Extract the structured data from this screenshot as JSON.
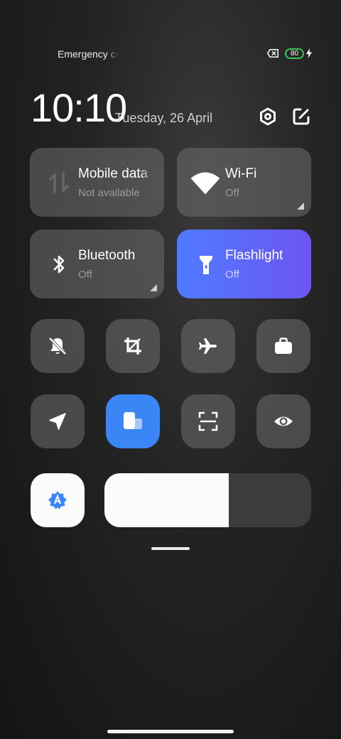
{
  "status_bar": {
    "carrier": "Emergency calls only",
    "battery_level": "80"
  },
  "header": {
    "time": "10:10",
    "date": "Tuesday, 26 April"
  },
  "tiles": {
    "mobile_data": {
      "title": "Mobile data",
      "subtitle": "Not available"
    },
    "wifi": {
      "title": "Wi-Fi",
      "subtitle": "Off"
    },
    "bluetooth": {
      "title": "Bluetooth",
      "subtitle": "Off"
    },
    "flashlight": {
      "title": "Flashlight",
      "subtitle": "Off"
    }
  },
  "toggles_row1": [
    "mute-icon",
    "screenshot-crop-icon",
    "airplane-icon",
    "work-mode-icon"
  ],
  "toggles_row2": [
    "location-icon",
    "floating-window-icon",
    "scanner-icon",
    "reading-mode-icon"
  ],
  "brightness": {
    "level": 0.6
  },
  "colors": {
    "accent": "#3b86f7",
    "flashlight_start": "#4f7bff",
    "flashlight_end": "#6d55f2",
    "battery": "#34c759"
  }
}
